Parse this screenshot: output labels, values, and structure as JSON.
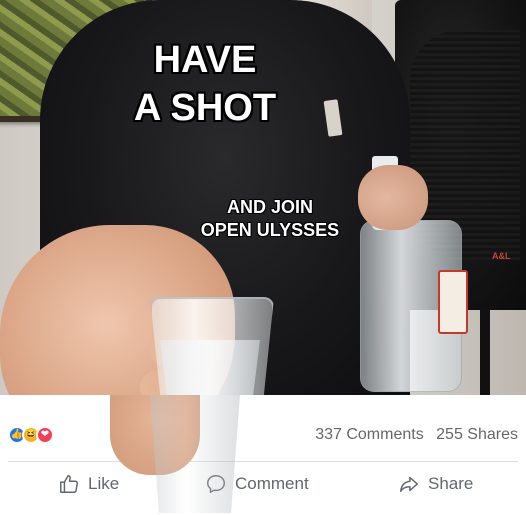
{
  "meme": {
    "line1": "HAVE",
    "line2": "A SHOT",
    "line3": "AND JOIN",
    "line4": "OPEN ULYSSES"
  },
  "speaker_brand": "A&L",
  "post_stats": {
    "comments": "337 Comments",
    "shares": "255 Shares",
    "reaction_icons": [
      "like-reaction-icon",
      "haha-reaction-icon",
      "love-reaction-icon"
    ]
  },
  "actions": {
    "like_label": "Like",
    "comment_label": "Comment",
    "share_label": "Share"
  },
  "colors": {
    "facebook_blue": "#1877f2",
    "stats_text": "#65676b",
    "action_text": "#606770"
  }
}
